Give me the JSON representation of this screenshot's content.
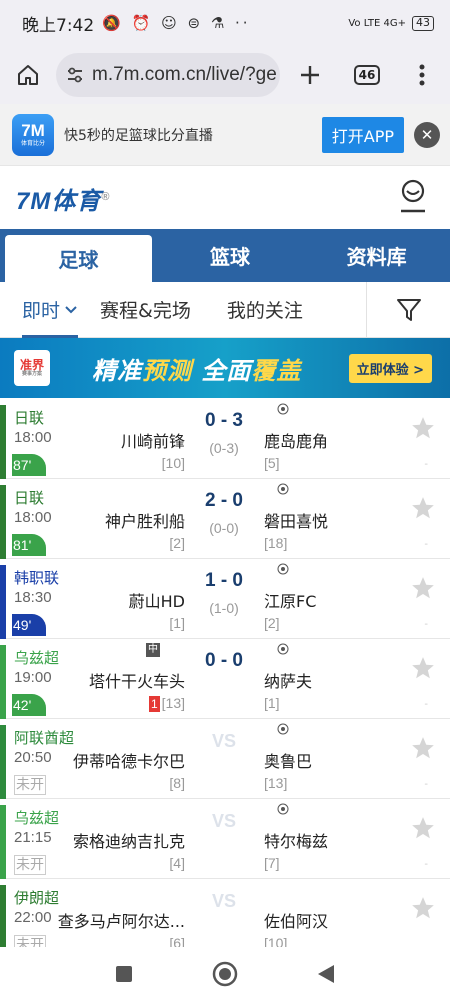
{
  "status": {
    "time": "晚上7:42",
    "icons": "🔕 ⏰ ☺ ⊜ ⚗ ··",
    "network": "Vo LTE 4G+",
    "battery": "43"
  },
  "browser": {
    "url": "m.7m.com.cn/live/?ge",
    "tab_count": "46"
  },
  "app_banner": {
    "logo_text": "7M",
    "logo_sub": "体育比分",
    "text": "快5秒的足篮球比分直播",
    "open_label": "打开APP",
    "close_label": "✕"
  },
  "site": {
    "brand": "7M体育",
    "reg": "®"
  },
  "sport_tabs": [
    {
      "label": "足球"
    },
    {
      "label": "篮球"
    },
    {
      "label": "资料库"
    }
  ],
  "subnav": {
    "live": "即时",
    "schedule": "赛程&完场",
    "mine": "我的关注"
  },
  "promo": {
    "logo": "准界",
    "logo_sub": "赛事方案",
    "title_a": "精准",
    "title_b": "预测",
    "title_c": " 全面",
    "title_d": "覆盖",
    "cta": "立即体验 >"
  },
  "matches": [
    {
      "league": "日联",
      "color": "#2e7d32",
      "time": "18:00",
      "home": "川崎前锋",
      "home_rank": "[10]",
      "score": "0 - 3",
      "ht": "(0-3)",
      "away": "鹿岛鹿角",
      "away_rank": "[5]",
      "minute": "87'",
      "started": true
    },
    {
      "league": "日联",
      "color": "#2e7d32",
      "time": "18:00",
      "home": "神户胜利船",
      "home_rank": "[2]",
      "score": "2 - 0",
      "ht": "(0-0)",
      "away": "磐田喜悦",
      "away_rank": "[18]",
      "minute": "81'",
      "started": true
    },
    {
      "league": "韩职联",
      "color": "#1a3fa8",
      "time": "18:30",
      "home": "蔚山HD",
      "home_rank": "[1]",
      "score": "1 - 0",
      "ht": "(1-0)",
      "away": "江原FC",
      "away_rank": "[2]",
      "minute": "49'",
      "started": true
    },
    {
      "league": "乌兹超",
      "color": "#3aa34a",
      "time": "19:00",
      "home": "塔什干火车头",
      "home_rank": "[13]",
      "score": "0 - 0",
      "ht": "",
      "away": "纳萨夫",
      "away_rank": "[1]",
      "minute": "42'",
      "started": true,
      "red_card": "1",
      "neutral": "中"
    },
    {
      "league": "阿联酋超",
      "color": "#2e8b3d",
      "time": "20:50",
      "home": "伊蒂哈德卡尔巴",
      "home_rank": "[8]",
      "vs": "VS",
      "away": "奥鲁巴",
      "away_rank": "[13]",
      "status": "未开",
      "started": false
    },
    {
      "league": "乌兹超",
      "color": "#3aa34a",
      "time": "21:15",
      "home": "索格迪纳吉扎克",
      "home_rank": "[4]",
      "vs": "VS",
      "away": "特尔梅兹",
      "away_rank": "[7]",
      "status": "未开",
      "started": false
    },
    {
      "league": "伊朗超",
      "color": "#2e7d32",
      "time": "22:00",
      "home": "查多马卢阿尔达...",
      "home_rank": "[6]",
      "vs": "VS",
      "away": "佐伯阿汉",
      "away_rank": "[10]",
      "status": "未开",
      "started": false
    }
  ],
  "colors": {
    "brand_blue": "#2b63a3",
    "score_navy": "#1a3e6e",
    "open_app_blue": "#1e88e5"
  }
}
